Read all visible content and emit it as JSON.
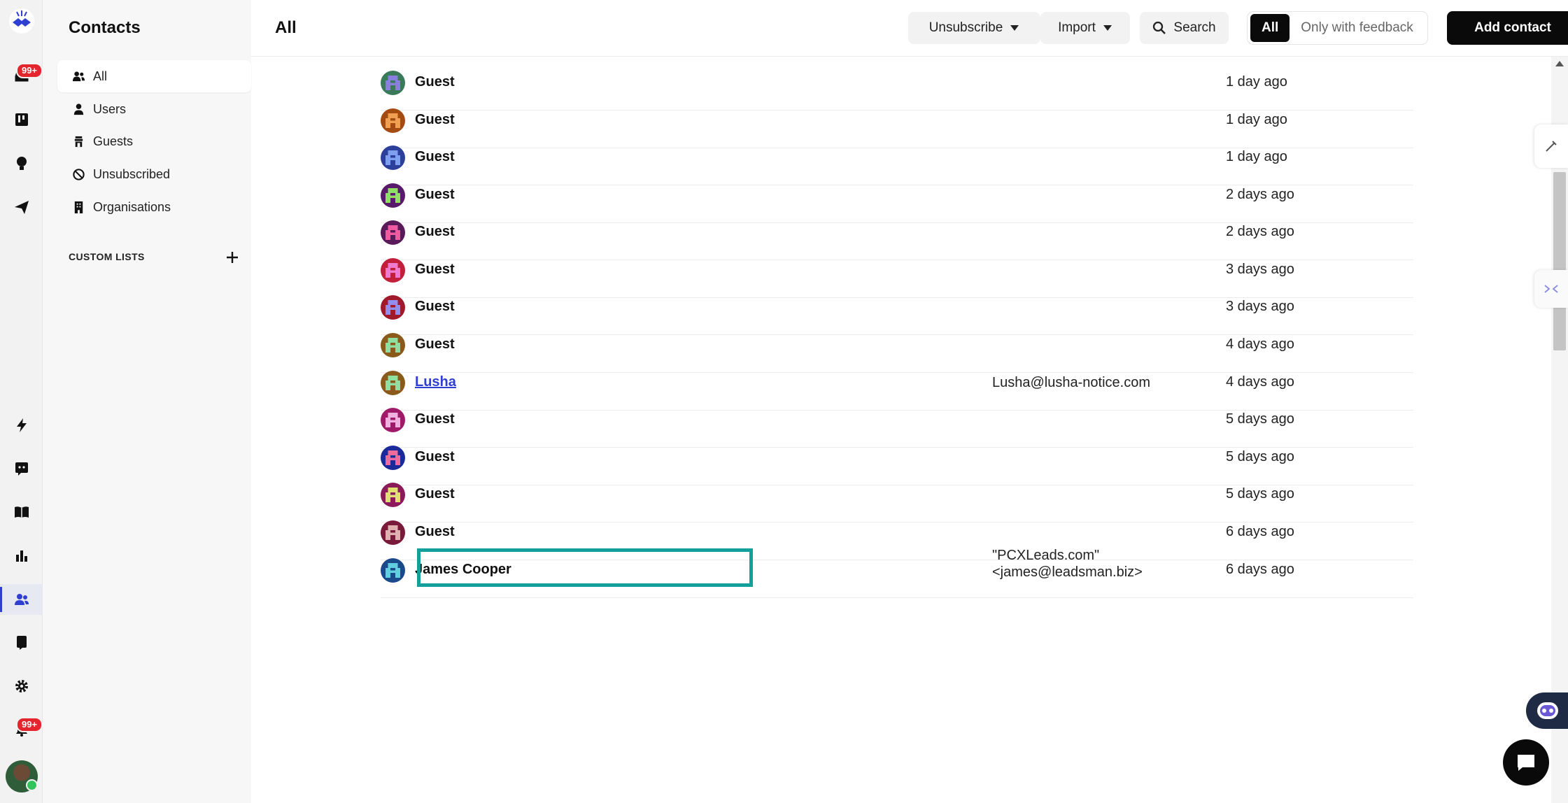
{
  "rail": {
    "inbox_badge": "99+",
    "notifications_badge": "99+",
    "icons": [
      "logo-icon",
      "inbox-icon",
      "board-icon",
      "lightbulb-icon",
      "send-icon",
      "bolt-icon",
      "chat-bot-icon",
      "book-icon",
      "chart-icon",
      "contacts-icon",
      "mobile-icon",
      "gear-icon",
      "bell-icon"
    ]
  },
  "sidebar": {
    "title": "Contacts",
    "items": [
      {
        "label": "All",
        "icon": "users-icon"
      },
      {
        "label": "Users",
        "icon": "user-icon"
      },
      {
        "label": "Guests",
        "icon": "guest-icon"
      },
      {
        "label": "Unsubscribed",
        "icon": "ban-icon"
      },
      {
        "label": "Organisations",
        "icon": "building-icon"
      }
    ],
    "custom_lists_label": "CUSTOM LISTS"
  },
  "header": {
    "title": "All",
    "unsubscribe_label": "Unsubscribe",
    "import_label": "Import",
    "search_label": "Search",
    "filter_all_label": "All",
    "filter_feedback_label": "Only with feedback",
    "add_contact_label": "Add contact"
  },
  "rows": [
    {
      "name": "Guest",
      "email": "",
      "time": "1 day ago",
      "colors": [
        "#3a7a5a",
        "#8a7fe0"
      ]
    },
    {
      "name": "Guest",
      "email": "",
      "time": "1 day ago",
      "colors": [
        "#a44b12",
        "#f0a050"
      ]
    },
    {
      "name": "Guest",
      "email": "",
      "time": "1 day ago",
      "colors": [
        "#2c3f9a",
        "#7f9ff0"
      ]
    },
    {
      "name": "Guest",
      "email": "",
      "time": "2 days ago",
      "colors": [
        "#5a1a6a",
        "#8fe060"
      ]
    },
    {
      "name": "Guest",
      "email": "",
      "time": "2 days ago",
      "colors": [
        "#5a1a5a",
        "#f05aa0"
      ]
    },
    {
      "name": "Guest",
      "email": "",
      "time": "3 days ago",
      "colors": [
        "#c2203a",
        "#f07ad0"
      ]
    },
    {
      "name": "Guest",
      "email": "",
      "time": "3 days ago",
      "colors": [
        "#a01a2a",
        "#8f8ff0"
      ]
    },
    {
      "name": "Guest",
      "email": "",
      "time": "4 days ago",
      "colors": [
        "#8a5a1a",
        "#8fe0a0"
      ]
    },
    {
      "name": "Lusha",
      "email": "Lusha@lusha-notice.com",
      "time": "4 days ago",
      "colors": [
        "#8a5a1a",
        "#8fe0a0"
      ],
      "link": true
    },
    {
      "name": "Guest",
      "email": "",
      "time": "5 days ago",
      "colors": [
        "#a01a6a",
        "#f0b0e0"
      ]
    },
    {
      "name": "Guest",
      "email": "",
      "time": "5 days ago",
      "colors": [
        "#1a2a9a",
        "#f06a9a"
      ]
    },
    {
      "name": "Guest",
      "email": "",
      "time": "5 days ago",
      "colors": [
        "#8a1a5a",
        "#e0e070"
      ]
    },
    {
      "name": "Guest",
      "email": "",
      "time": "6 days ago",
      "colors": [
        "#7a1a3a",
        "#e0b0b0"
      ]
    },
    {
      "name": "James Cooper",
      "email": "\"PCXLeads.com\" <james@leadsman.biz>",
      "time": "6 days ago",
      "colors": [
        "#1a4a8a",
        "#60d0e0"
      ]
    }
  ]
}
